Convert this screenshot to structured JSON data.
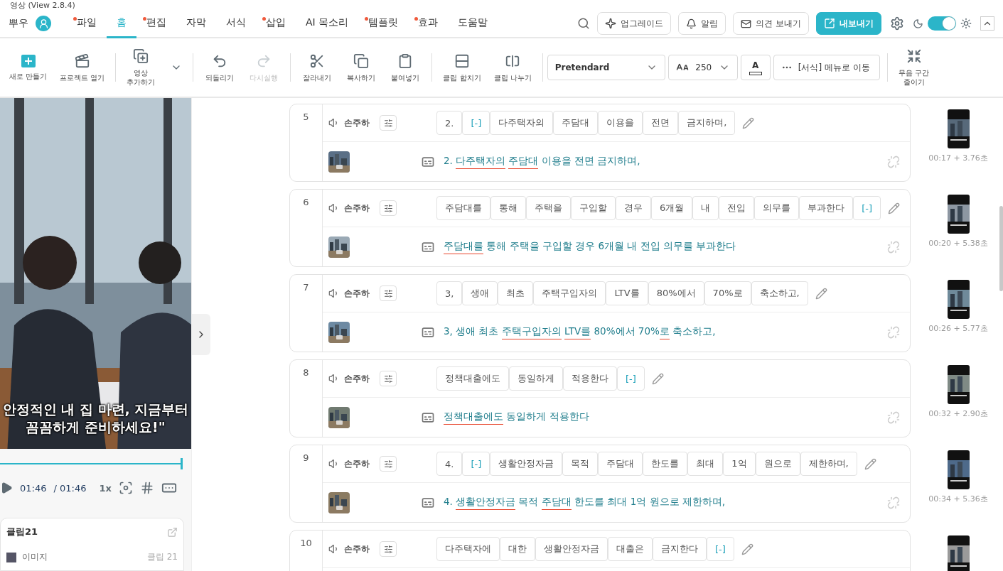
{
  "window": {
    "title": "영상 (View 2.8.4)"
  },
  "user": {
    "name": "뿌우"
  },
  "menu_tabs": [
    {
      "label": "파일",
      "dot": true,
      "selected": false
    },
    {
      "label": "홈",
      "dot": false,
      "selected": true
    },
    {
      "label": "편집",
      "dot": true,
      "selected": false
    },
    {
      "label": "자막",
      "dot": false,
      "selected": false
    },
    {
      "label": "서식",
      "dot": false,
      "selected": false
    },
    {
      "label": "삽입",
      "dot": true,
      "selected": false
    },
    {
      "label": "AI 목소리",
      "dot": false,
      "selected": false
    },
    {
      "label": "템플릿",
      "dot": true,
      "selected": false
    },
    {
      "label": "효과",
      "dot": true,
      "selected": false
    },
    {
      "label": "도움말",
      "dot": false,
      "selected": false
    }
  ],
  "header_buttons": [
    {
      "kind": "upgrade",
      "label": "업그레이드"
    },
    {
      "kind": "alerts",
      "label": "알림"
    },
    {
      "kind": "feedback",
      "label": "의견 보내기"
    },
    {
      "kind": "export",
      "label": "내보내기"
    }
  ],
  "theme_toggle": {
    "on": true
  },
  "toolbar": [
    {
      "kind": "new",
      "label": "새로 만들기",
      "disabled": false
    },
    {
      "kind": "open",
      "label": "프로젝트 열기",
      "disabled": false
    },
    {
      "kind": "sep"
    },
    {
      "kind": "add",
      "label": "영상\n추가하기",
      "disabled": false
    },
    {
      "kind": "sep"
    },
    {
      "kind": "undo",
      "label": "되돌리기",
      "disabled": false
    },
    {
      "kind": "redo",
      "label": "다시실행",
      "disabled": true
    },
    {
      "kind": "sep"
    },
    {
      "kind": "cut",
      "label": "잘라내기",
      "disabled": false
    },
    {
      "kind": "copy",
      "label": "복사하기",
      "disabled": false
    },
    {
      "kind": "paste",
      "label": "붙여넣기",
      "disabled": false
    },
    {
      "kind": "sep"
    },
    {
      "kind": "merge",
      "label": "클립 합치기",
      "disabled": false
    },
    {
      "kind": "split",
      "label": "클립 나누기",
      "disabled": false
    },
    {
      "kind": "sep"
    },
    {
      "kind": "font",
      "label": "Pretendard"
    },
    {
      "kind": "size",
      "label": "250"
    },
    {
      "kind": "color",
      "label": "A"
    },
    {
      "kind": "format",
      "label": "[서식] 메뉴로 이동"
    },
    {
      "kind": "sep"
    },
    {
      "kind": "silence",
      "label": "무음 구간\n줄이기",
      "disabled": false
    }
  ],
  "player": {
    "caption": [
      "안정적인 내 집 마련, 지금부터",
      "꼼꼼하게 준비하세요!\""
    ],
    "level": 1,
    "current": "01:46",
    "total": "/ 01:46",
    "speed": "1x"
  },
  "clip_panel": {
    "title": "클립21",
    "item_type": "이미지",
    "item_clip": "클립 21"
  },
  "clips": [
    {
      "number": "5",
      "speaker": "손주하",
      "chips": [
        {
          "text": "2.",
          "kind": "word"
        },
        {
          "text": "[-]",
          "kind": "pause"
        },
        {
          "text": "다주택자의",
          "kind": "word"
        },
        {
          "text": "주담대",
          "kind": "word"
        },
        {
          "text": "이용을",
          "kind": "word"
        },
        {
          "text": "전면",
          "kind": "word"
        },
        {
          "text": "금지하며,",
          "kind": "word"
        }
      ],
      "subtitle": [
        {
          "text": "2.",
          "flagged": false
        },
        {
          "text": "다주택자의",
          "flagged": true
        },
        {
          "text": "주담대",
          "flagged": true
        },
        {
          "text": "이용을 전면 금지하며,",
          "flagged": false
        }
      ],
      "time": "00:17 + 3.76초"
    },
    {
      "number": "6",
      "speaker": "손주하",
      "chips": [
        {
          "text": "주담대를",
          "kind": "word"
        },
        {
          "text": "통해",
          "kind": "word"
        },
        {
          "text": "주택을",
          "kind": "word"
        },
        {
          "text": "구입할",
          "kind": "word"
        },
        {
          "text": "경우",
          "kind": "word"
        },
        {
          "text": "6개월",
          "kind": "word"
        },
        {
          "text": "내",
          "kind": "word"
        },
        {
          "text": "전입",
          "kind": "word"
        },
        {
          "text": "의무를",
          "kind": "word"
        },
        {
          "text": "부과한다",
          "kind": "word"
        },
        {
          "text": "[-]",
          "kind": "pause"
        }
      ],
      "subtitle": [
        {
          "text": "주담대를",
          "flagged": true
        },
        {
          "text": "통해 주택을 구입할 경우 6개월 내 전입 의무를 부과한다",
          "flagged": false
        }
      ],
      "time": "00:20 + 5.38초"
    },
    {
      "number": "7",
      "speaker": "손주하",
      "chips": [
        {
          "text": "3,",
          "kind": "word"
        },
        {
          "text": "생애",
          "kind": "word"
        },
        {
          "text": "최초",
          "kind": "word"
        },
        {
          "text": "주택구입자의",
          "kind": "word"
        },
        {
          "text": "LTV를",
          "kind": "word"
        },
        {
          "text": "80%에서",
          "kind": "word"
        },
        {
          "text": "70%로",
          "kind": "word"
        },
        {
          "text": "축소하고,",
          "kind": "word"
        }
      ],
      "subtitle": [
        {
          "text": "3, 생애 최초",
          "flagged": false
        },
        {
          "text": "주택구입자의",
          "flagged": true
        },
        {
          "text": "LTV를",
          "flagged": true
        },
        {
          "text": "80%에서 70%",
          "flagged": false
        },
        {
          "text": "로",
          "flagged": true,
          "attached": true
        },
        {
          "text": "축소하고,",
          "flagged": false
        }
      ],
      "time": "00:26 + 5.77초"
    },
    {
      "number": "8",
      "speaker": "손주하",
      "chips": [
        {
          "text": "정책대출에도",
          "kind": "word"
        },
        {
          "text": "동일하게",
          "kind": "word"
        },
        {
          "text": "적용한다",
          "kind": "word"
        },
        {
          "text": "[-]",
          "kind": "pause"
        }
      ],
      "subtitle": [
        {
          "text": "정책대출에도",
          "flagged": true
        },
        {
          "text": "동일하게 적용한다",
          "flagged": false
        }
      ],
      "time": "00:32 + 2.90초"
    },
    {
      "number": "9",
      "speaker": "손주하",
      "chips": [
        {
          "text": "4.",
          "kind": "word"
        },
        {
          "text": "[-]",
          "kind": "pause"
        },
        {
          "text": "생활안정자금",
          "kind": "word"
        },
        {
          "text": "목적",
          "kind": "word"
        },
        {
          "text": "주담대",
          "kind": "word"
        },
        {
          "text": "한도를",
          "kind": "word"
        },
        {
          "text": "최대",
          "kind": "word"
        },
        {
          "text": "1억",
          "kind": "word"
        },
        {
          "text": "원으로",
          "kind": "word"
        },
        {
          "text": "제한하며,",
          "kind": "word"
        }
      ],
      "subtitle": [
        {
          "text": "4.",
          "flagged": false
        },
        {
          "text": "생활안정자금",
          "flagged": true
        },
        {
          "text": "목적",
          "flagged": false
        },
        {
          "text": "주담대",
          "flagged": true
        },
        {
          "text": "한도를 최대 1억 원으로 제한하며,",
          "flagged": false
        }
      ],
      "time": "00:34 + 5.36초"
    },
    {
      "number": "10",
      "speaker": "손주하",
      "chips": [
        {
          "text": "다주택자에",
          "kind": "word"
        },
        {
          "text": "대한",
          "kind": "word"
        },
        {
          "text": "생활안정자금",
          "kind": "word"
        },
        {
          "text": "대출은",
          "kind": "word"
        },
        {
          "text": "금지한다",
          "kind": "word"
        },
        {
          "text": "[-]",
          "kind": "pause"
        }
      ]
    }
  ]
}
